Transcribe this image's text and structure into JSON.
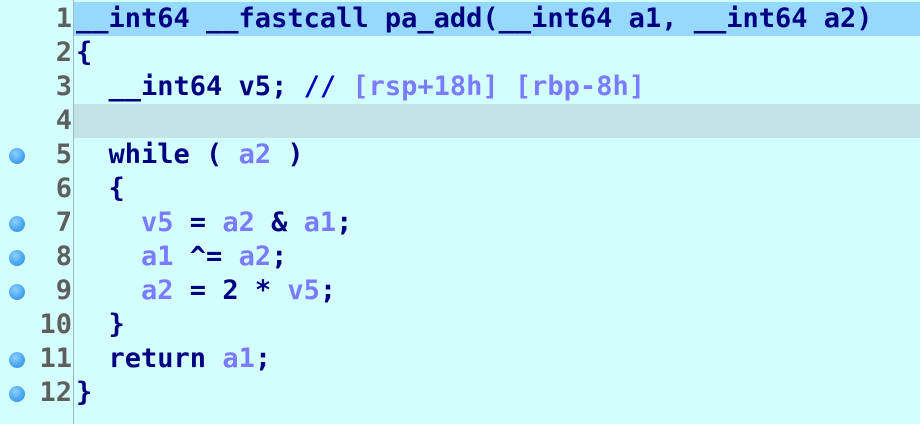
{
  "lines": [
    {
      "num": "1",
      "bp": false,
      "sel": true,
      "cur": false
    },
    {
      "num": "2",
      "bp": false,
      "sel": false,
      "cur": false
    },
    {
      "num": "3",
      "bp": false,
      "sel": false,
      "cur": false
    },
    {
      "num": "4",
      "bp": false,
      "sel": false,
      "cur": true
    },
    {
      "num": "5",
      "bp": true,
      "sel": false,
      "cur": false
    },
    {
      "num": "6",
      "bp": false,
      "sel": false,
      "cur": false
    },
    {
      "num": "7",
      "bp": true,
      "sel": false,
      "cur": false
    },
    {
      "num": "8",
      "bp": true,
      "sel": false,
      "cur": false
    },
    {
      "num": "9",
      "bp": true,
      "sel": false,
      "cur": false
    },
    {
      "num": "10",
      "bp": false,
      "sel": false,
      "cur": false
    },
    {
      "num": "11",
      "bp": true,
      "sel": false,
      "cur": false
    },
    {
      "num": "12",
      "bp": true,
      "sel": false,
      "cur": false
    }
  ],
  "code": {
    "l1": {
      "t1": "__int64 __fastcall pa_add(",
      "t2": "__int64 a1, __int64 a2)"
    },
    "l2": {
      "t": "{"
    },
    "l3": {
      "t1": "  __int64 v5; ",
      "t2": "// ",
      "t3": "[rsp+18h] [rbp-8h]"
    },
    "l4": {
      "t": ""
    },
    "l5": {
      "kw": "  while ( ",
      "v": "a2",
      "end": " )"
    },
    "l6": {
      "t": "  {"
    },
    "l7": {
      "v1": "v5",
      "op1": " = ",
      "v2": "a2",
      "op2": " & ",
      "v3": "a1",
      "end": ";"
    },
    "l8": {
      "v1": "a1",
      "op1": " ^= ",
      "v2": "a2",
      "end": ";"
    },
    "l9": {
      "v1": "a2",
      "op1": " = 2 * ",
      "v2": "v5",
      "end": ";"
    },
    "l10": {
      "t": "  }"
    },
    "l11": {
      "kw": "  return ",
      "v": "a1",
      "end": ";"
    },
    "l12": {
      "t": "}"
    }
  },
  "colors": {
    "background": "#d4ffff",
    "selected_line": "#97d8ff",
    "current_line": "#c3e4e6",
    "keyword": "#000080",
    "variable": "#7b7bff",
    "breakpoint": "#4aa8f2"
  }
}
